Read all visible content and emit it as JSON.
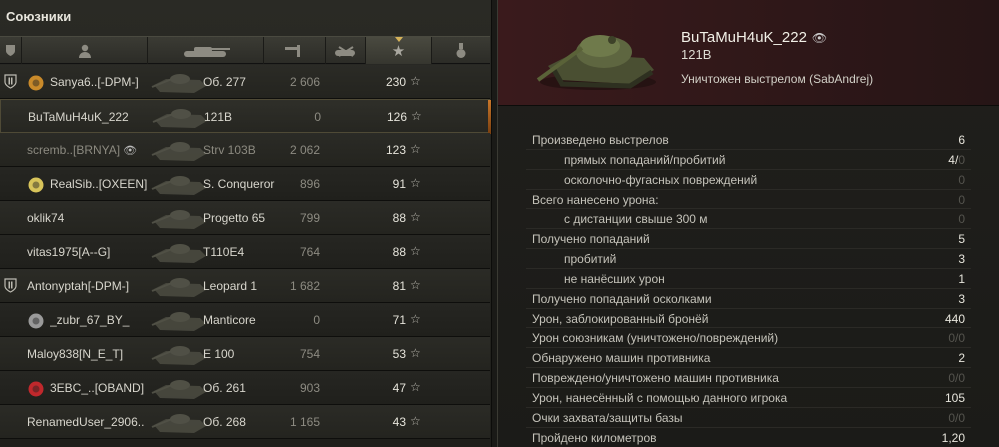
{
  "allies": {
    "title": "Союзники",
    "columns": [
      "platoon-icon",
      "player-icon",
      "tank-icon",
      "damage-icon",
      "kills-icon",
      "xp-star-icon",
      "medal-icon"
    ],
    "rows": [
      {
        "platoon": true,
        "clan_color": "#c98a2a",
        "name": "Sanya6..[-DPM-]",
        "eye": false,
        "vehicle": "Об. 277",
        "damage": "2 606",
        "xp": "230",
        "player": false,
        "dead": false
      },
      {
        "platoon": false,
        "clan_color": "",
        "name": "BuTaMuH4uK_222",
        "eye": false,
        "vehicle": "121B",
        "damage": "0",
        "xp": "126",
        "player": true,
        "dead": false
      },
      {
        "platoon": false,
        "clan_color": "",
        "name": "scremb..[BRNYA]",
        "eye": true,
        "vehicle": "Strv 103B",
        "damage": "2 062",
        "xp": "123",
        "player": false,
        "dead": true
      },
      {
        "platoon": false,
        "clan_color": "#d8c45a",
        "name": "RealSib..[OXEEN]",
        "eye": false,
        "vehicle": "S. Conqueror",
        "damage": "896",
        "xp": "91",
        "player": false,
        "dead": false
      },
      {
        "platoon": false,
        "clan_color": "",
        "name": "oklik74",
        "eye": false,
        "vehicle": "Progetto 65",
        "damage": "799",
        "xp": "88",
        "player": false,
        "dead": false
      },
      {
        "platoon": false,
        "clan_color": "",
        "name": "vitas1975[A--G]",
        "eye": false,
        "vehicle": "T110E4",
        "damage": "764",
        "xp": "88",
        "player": false,
        "dead": false
      },
      {
        "platoon": true,
        "clan_color": "",
        "name": "Antonyptah[-DPM-]",
        "eye": false,
        "vehicle": "Leopard 1",
        "damage": "1 682",
        "xp": "81",
        "player": false,
        "dead": false
      },
      {
        "platoon": false,
        "clan_color": "#9a9a9a",
        "name": "_zubr_67_BY_",
        "eye": false,
        "vehicle": "Manticore",
        "damage": "0",
        "xp": "71",
        "player": false,
        "dead": false
      },
      {
        "platoon": false,
        "clan_color": "",
        "name": "Maloy838[N_E_T]",
        "eye": false,
        "vehicle": "E 100",
        "damage": "754",
        "xp": "53",
        "player": false,
        "dead": false
      },
      {
        "platoon": false,
        "clan_color": "#c0282c",
        "name": "3EBC_..[OBAND]",
        "eye": false,
        "vehicle": "Об. 261",
        "damage": "903",
        "xp": "47",
        "player": false,
        "dead": false
      },
      {
        "platoon": false,
        "clan_color": "",
        "name": "RenamedUser_2906..",
        "eye": false,
        "vehicle": "Об. 268",
        "damage": "1 165",
        "xp": "43",
        "player": false,
        "dead": false
      }
    ]
  },
  "detail": {
    "player_name": "BuTaMuH4uK_222",
    "vehicle": "121B",
    "kill_info": "Уничтожен выстрелом (SabAndrej)",
    "stats": [
      {
        "label": "Произведено выстрелов",
        "value": "6",
        "sub": false,
        "dim_value": false
      },
      {
        "label": "прямых попаданий/пробитий",
        "value": "4/",
        "tail": "0",
        "sub": true,
        "dim_value": false
      },
      {
        "label": "осколочно-фугасных повреждений",
        "value": "0",
        "sub": true,
        "dim_value": true
      },
      {
        "label": "Всего нанесено урона:",
        "value": "0",
        "sub": false,
        "dim_value": true
      },
      {
        "label": "с дистанции свыше 300 м",
        "value": "0",
        "sub": true,
        "dim_value": true
      },
      {
        "label": "Получено попаданий",
        "value": "5",
        "sub": false,
        "dim_value": false
      },
      {
        "label": "пробитий",
        "value": "3",
        "sub": true,
        "dim_value": false
      },
      {
        "label": "не нанёсших урон",
        "value": "1",
        "sub": true,
        "dim_value": false
      },
      {
        "label": "Получено попаданий осколками",
        "value": "3",
        "sub": false,
        "dim_value": false
      },
      {
        "label": "Урон, заблокированный бронёй",
        "value": "440",
        "sub": false,
        "dim_value": false
      },
      {
        "label": "Урон союзникам (уничтожено/повреждений)",
        "value": "0/0",
        "sub": false,
        "dim_value": true
      },
      {
        "label": "Обнаружено машин противника",
        "value": "2",
        "sub": false,
        "dim_value": false
      },
      {
        "label": "Повреждено/уничтожено машин противника",
        "value": "0/0",
        "sub": false,
        "dim_value": true
      },
      {
        "label": "Урон, нанесённый с помощью данного игрока",
        "value": "105",
        "sub": false,
        "dim_value": false
      },
      {
        "label": "Очки захвата/защиты базы",
        "value": "0/0",
        "sub": false,
        "dim_value": true
      },
      {
        "label": "Пройдено километров",
        "value": "1,20",
        "sub": false,
        "dim_value": false
      }
    ]
  },
  "colors": {
    "accent": "#c9772a",
    "panel_top": "#3a1a1c",
    "dim_text": "#55544e"
  }
}
